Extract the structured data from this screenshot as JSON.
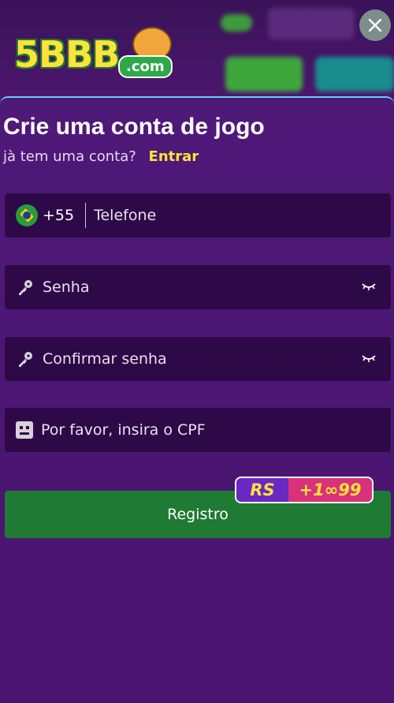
{
  "header": {
    "logo_text": "5BBB",
    "logo_domain": ".com"
  },
  "form": {
    "title": "Crie uma conta de jogo",
    "subtitle": "jà tem uma conta?",
    "login_link": "Entrar",
    "phone": {
      "country_code": "+55",
      "placeholder": "Telefone",
      "flag": "brazil-flag"
    },
    "password": {
      "placeholder": "Senha"
    },
    "confirm_password": {
      "placeholder": "Confirmar senha"
    },
    "cpf": {
      "placeholder": "Por favor, insira o CPF"
    },
    "register_label": "Registro",
    "bonus_badge": {
      "currency": "RS",
      "amount": "+1∞99"
    }
  },
  "colors": {
    "background": "#4a1470",
    "field": "#2d0a47",
    "accent_yellow": "#ffe23b",
    "register_green": "#1f7a34",
    "panel_border": "#5fd2ee"
  }
}
